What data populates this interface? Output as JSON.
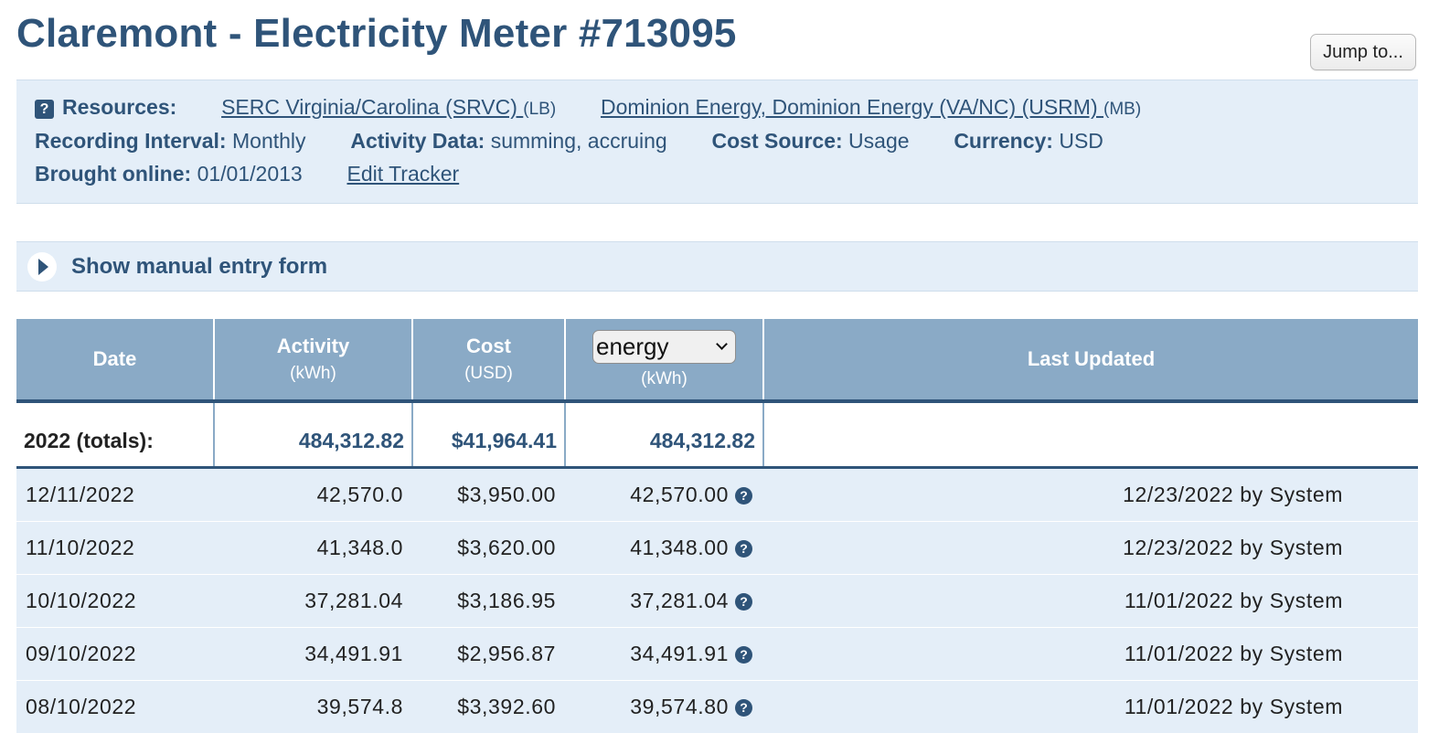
{
  "title": "Claremont - Electricity Meter #713095",
  "jump_button": "Jump to...",
  "info": {
    "help_icon": "?",
    "resources_label": "Resources:",
    "resource_links": [
      {
        "text": "SERC Virginia/Carolina (SRVC) ",
        "tag": "(LB)"
      },
      {
        "text": "Dominion Energy, Dominion Energy (VA/NC) (USRM) ",
        "tag": "(MB)"
      }
    ],
    "recording_interval_label": "Recording Interval:",
    "recording_interval": "Monthly",
    "activity_data_label": "Activity Data:",
    "activity_data": "summing, accruing",
    "cost_source_label": "Cost Source:",
    "cost_source": "Usage",
    "currency_label": "Currency:",
    "currency": "USD",
    "brought_online_label": "Brought online:",
    "brought_online": "01/01/2013",
    "edit_link": "Edit Tracker"
  },
  "manual_entry": {
    "label": "Show manual entry form"
  },
  "table": {
    "headers": {
      "date": "Date",
      "activity": "Activity",
      "activity_unit": "(kWh)",
      "cost": "Cost",
      "cost_unit": "(USD)",
      "energy_select": "energy",
      "energy_unit": "(kWh)",
      "last_updated": "Last Updated"
    },
    "totals": {
      "label": "2022 (totals):",
      "activity": "484,312.82",
      "cost": "$41,964.41",
      "energy": "484,312.82"
    },
    "rows": [
      {
        "date": "12/11/2022",
        "activity": "42,570.0",
        "cost": "$3,950.00",
        "energy": "42,570.00",
        "updated": "12/23/2022 by System"
      },
      {
        "date": "11/10/2022",
        "activity": "41,348.0",
        "cost": "$3,620.00",
        "energy": "41,348.00",
        "updated": "12/23/2022 by System"
      },
      {
        "date": "10/10/2022",
        "activity": "37,281.04",
        "cost": "$3,186.95",
        "energy": "37,281.04",
        "updated": "11/01/2022 by System"
      },
      {
        "date": "09/10/2022",
        "activity": "34,491.91",
        "cost": "$2,956.87",
        "energy": "34,491.91",
        "updated": "11/01/2022 by System"
      },
      {
        "date": "08/10/2022",
        "activity": "39,574.8",
        "cost": "$3,392.60",
        "energy": "39,574.80",
        "updated": "11/01/2022 by System"
      }
    ],
    "row_help_icon": "?"
  },
  "colors": {
    "brand": "#2f5479",
    "panel": "#e4eef8",
    "header": "#8aaac6"
  }
}
